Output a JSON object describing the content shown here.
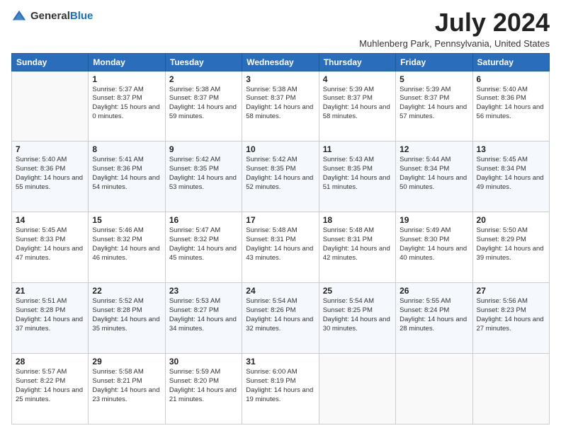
{
  "logo": {
    "general": "General",
    "blue": "Blue"
  },
  "title": {
    "month": "July 2024",
    "location": "Muhlenberg Park, Pennsylvania, United States"
  },
  "headers": [
    "Sunday",
    "Monday",
    "Tuesday",
    "Wednesday",
    "Thursday",
    "Friday",
    "Saturday"
  ],
  "weeks": [
    [
      {
        "day": "",
        "sunrise": "",
        "sunset": "",
        "daylight": ""
      },
      {
        "day": "1",
        "sunrise": "Sunrise: 5:37 AM",
        "sunset": "Sunset: 8:37 PM",
        "daylight": "Daylight: 15 hours and 0 minutes."
      },
      {
        "day": "2",
        "sunrise": "Sunrise: 5:38 AM",
        "sunset": "Sunset: 8:37 PM",
        "daylight": "Daylight: 14 hours and 59 minutes."
      },
      {
        "day": "3",
        "sunrise": "Sunrise: 5:38 AM",
        "sunset": "Sunset: 8:37 PM",
        "daylight": "Daylight: 14 hours and 58 minutes."
      },
      {
        "day": "4",
        "sunrise": "Sunrise: 5:39 AM",
        "sunset": "Sunset: 8:37 PM",
        "daylight": "Daylight: 14 hours and 58 minutes."
      },
      {
        "day": "5",
        "sunrise": "Sunrise: 5:39 AM",
        "sunset": "Sunset: 8:37 PM",
        "daylight": "Daylight: 14 hours and 57 minutes."
      },
      {
        "day": "6",
        "sunrise": "Sunrise: 5:40 AM",
        "sunset": "Sunset: 8:36 PM",
        "daylight": "Daylight: 14 hours and 56 minutes."
      }
    ],
    [
      {
        "day": "7",
        "sunrise": "Sunrise: 5:40 AM",
        "sunset": "Sunset: 8:36 PM",
        "daylight": "Daylight: 14 hours and 55 minutes."
      },
      {
        "day": "8",
        "sunrise": "Sunrise: 5:41 AM",
        "sunset": "Sunset: 8:36 PM",
        "daylight": "Daylight: 14 hours and 54 minutes."
      },
      {
        "day": "9",
        "sunrise": "Sunrise: 5:42 AM",
        "sunset": "Sunset: 8:35 PM",
        "daylight": "Daylight: 14 hours and 53 minutes."
      },
      {
        "day": "10",
        "sunrise": "Sunrise: 5:42 AM",
        "sunset": "Sunset: 8:35 PM",
        "daylight": "Daylight: 14 hours and 52 minutes."
      },
      {
        "day": "11",
        "sunrise": "Sunrise: 5:43 AM",
        "sunset": "Sunset: 8:35 PM",
        "daylight": "Daylight: 14 hours and 51 minutes."
      },
      {
        "day": "12",
        "sunrise": "Sunrise: 5:44 AM",
        "sunset": "Sunset: 8:34 PM",
        "daylight": "Daylight: 14 hours and 50 minutes."
      },
      {
        "day": "13",
        "sunrise": "Sunrise: 5:45 AM",
        "sunset": "Sunset: 8:34 PM",
        "daylight": "Daylight: 14 hours and 49 minutes."
      }
    ],
    [
      {
        "day": "14",
        "sunrise": "Sunrise: 5:45 AM",
        "sunset": "Sunset: 8:33 PM",
        "daylight": "Daylight: 14 hours and 47 minutes."
      },
      {
        "day": "15",
        "sunrise": "Sunrise: 5:46 AM",
        "sunset": "Sunset: 8:32 PM",
        "daylight": "Daylight: 14 hours and 46 minutes."
      },
      {
        "day": "16",
        "sunrise": "Sunrise: 5:47 AM",
        "sunset": "Sunset: 8:32 PM",
        "daylight": "Daylight: 14 hours and 45 minutes."
      },
      {
        "day": "17",
        "sunrise": "Sunrise: 5:48 AM",
        "sunset": "Sunset: 8:31 PM",
        "daylight": "Daylight: 14 hours and 43 minutes."
      },
      {
        "day": "18",
        "sunrise": "Sunrise: 5:48 AM",
        "sunset": "Sunset: 8:31 PM",
        "daylight": "Daylight: 14 hours and 42 minutes."
      },
      {
        "day": "19",
        "sunrise": "Sunrise: 5:49 AM",
        "sunset": "Sunset: 8:30 PM",
        "daylight": "Daylight: 14 hours and 40 minutes."
      },
      {
        "day": "20",
        "sunrise": "Sunrise: 5:50 AM",
        "sunset": "Sunset: 8:29 PM",
        "daylight": "Daylight: 14 hours and 39 minutes."
      }
    ],
    [
      {
        "day": "21",
        "sunrise": "Sunrise: 5:51 AM",
        "sunset": "Sunset: 8:28 PM",
        "daylight": "Daylight: 14 hours and 37 minutes."
      },
      {
        "day": "22",
        "sunrise": "Sunrise: 5:52 AM",
        "sunset": "Sunset: 8:28 PM",
        "daylight": "Daylight: 14 hours and 35 minutes."
      },
      {
        "day": "23",
        "sunrise": "Sunrise: 5:53 AM",
        "sunset": "Sunset: 8:27 PM",
        "daylight": "Daylight: 14 hours and 34 minutes."
      },
      {
        "day": "24",
        "sunrise": "Sunrise: 5:54 AM",
        "sunset": "Sunset: 8:26 PM",
        "daylight": "Daylight: 14 hours and 32 minutes."
      },
      {
        "day": "25",
        "sunrise": "Sunrise: 5:54 AM",
        "sunset": "Sunset: 8:25 PM",
        "daylight": "Daylight: 14 hours and 30 minutes."
      },
      {
        "day": "26",
        "sunrise": "Sunrise: 5:55 AM",
        "sunset": "Sunset: 8:24 PM",
        "daylight": "Daylight: 14 hours and 28 minutes."
      },
      {
        "day": "27",
        "sunrise": "Sunrise: 5:56 AM",
        "sunset": "Sunset: 8:23 PM",
        "daylight": "Daylight: 14 hours and 27 minutes."
      }
    ],
    [
      {
        "day": "28",
        "sunrise": "Sunrise: 5:57 AM",
        "sunset": "Sunset: 8:22 PM",
        "daylight": "Daylight: 14 hours and 25 minutes."
      },
      {
        "day": "29",
        "sunrise": "Sunrise: 5:58 AM",
        "sunset": "Sunset: 8:21 PM",
        "daylight": "Daylight: 14 hours and 23 minutes."
      },
      {
        "day": "30",
        "sunrise": "Sunrise: 5:59 AM",
        "sunset": "Sunset: 8:20 PM",
        "daylight": "Daylight: 14 hours and 21 minutes."
      },
      {
        "day": "31",
        "sunrise": "Sunrise: 6:00 AM",
        "sunset": "Sunset: 8:19 PM",
        "daylight": "Daylight: 14 hours and 19 minutes."
      },
      {
        "day": "",
        "sunrise": "",
        "sunset": "",
        "daylight": ""
      },
      {
        "day": "",
        "sunrise": "",
        "sunset": "",
        "daylight": ""
      },
      {
        "day": "",
        "sunrise": "",
        "sunset": "",
        "daylight": ""
      }
    ]
  ]
}
